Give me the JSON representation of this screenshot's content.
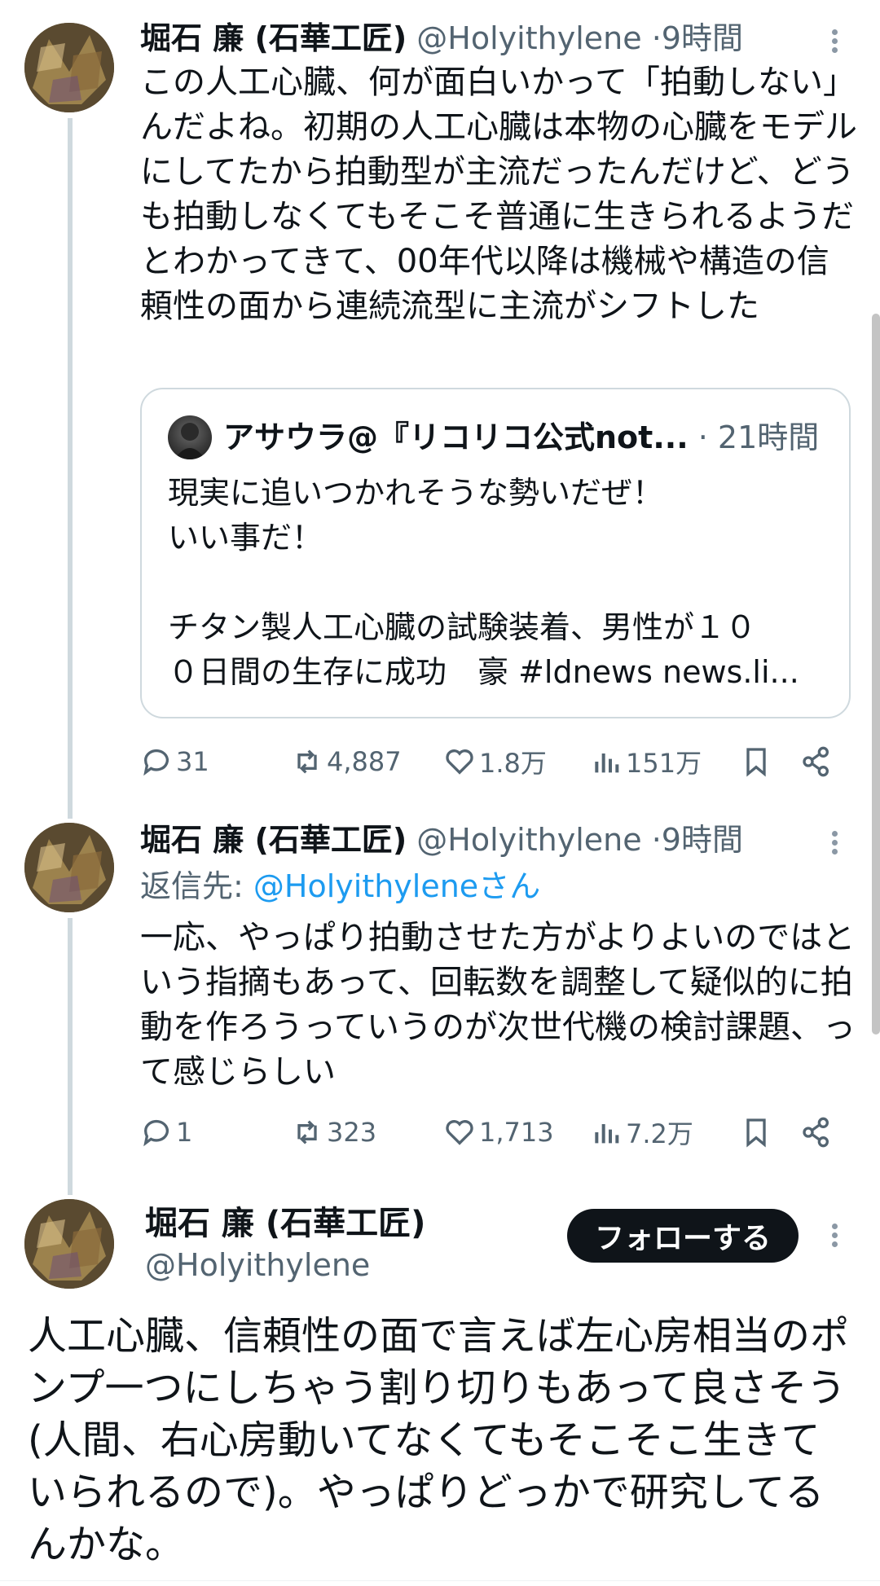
{
  "tweet1": {
    "display_name": "堀石 廉 (石華工匠)",
    "handle": "@Holyithylene",
    "separator": "·",
    "time": "9時間",
    "text": "この人工心臓、何が面白いかって「拍動しない」んだよね。初期の人工心臓は本物の心臓をモデルにしてたから拍動型が主流だったんだけど、どうも拍動しなくてもそこそ普通に生きられるようだとわかってきて、00年代以降は機械や構造の信頼性の面から連続流型に主流がシフトした",
    "quote": {
      "display_name": "アサウラ@『リコリコ公式not...",
      "separator": "·",
      "time": "21時間",
      "text": "現実に追いつかれそうな勢いだぜ！\nいい事だ！\n\nチタン製人工心臓の試験装着、男性が１０\n０日間の生存に成功　豪 #ldnews news.li..."
    },
    "actions": {
      "replies": "31",
      "retweets": "4,887",
      "likes": "1.8万",
      "views": "151万"
    }
  },
  "tweet2": {
    "display_name": "堀石 廉 (石華工匠)",
    "handle": "@Holyithylene",
    "separator": "·",
    "time": "9時間",
    "reply_prefix": "返信先: ",
    "reply_target": "@Holyithyleneさん",
    "text": "一応、やっぱり拍動させた方がよりよいのではという指摘もあって、回転数を調整して疑似的に拍動を作ろうっていうのが次世代機の検討課題、って感じらしい",
    "actions": {
      "replies": "1",
      "retweets": "323",
      "likes": "1,713",
      "views": "7.2万"
    }
  },
  "main_tweet": {
    "display_name": "堀石 廉 (石華工匠)",
    "handle": "@Holyithylene",
    "follow_label": "フォローする",
    "text": "人工心臓、信頼性の面で言えば左心房相当のポンプ一つにしちゃう割り切りもあって良さそう(人間、右心房動いてなくてもそこそこ生きていられるので)。やっぱりどっかで研究してるんかな。"
  },
  "colors": {
    "text": "#0f1419",
    "muted": "#536471",
    "link": "#1d9bf0",
    "border": "#cfd9de",
    "button_bg": "#0f1419"
  }
}
